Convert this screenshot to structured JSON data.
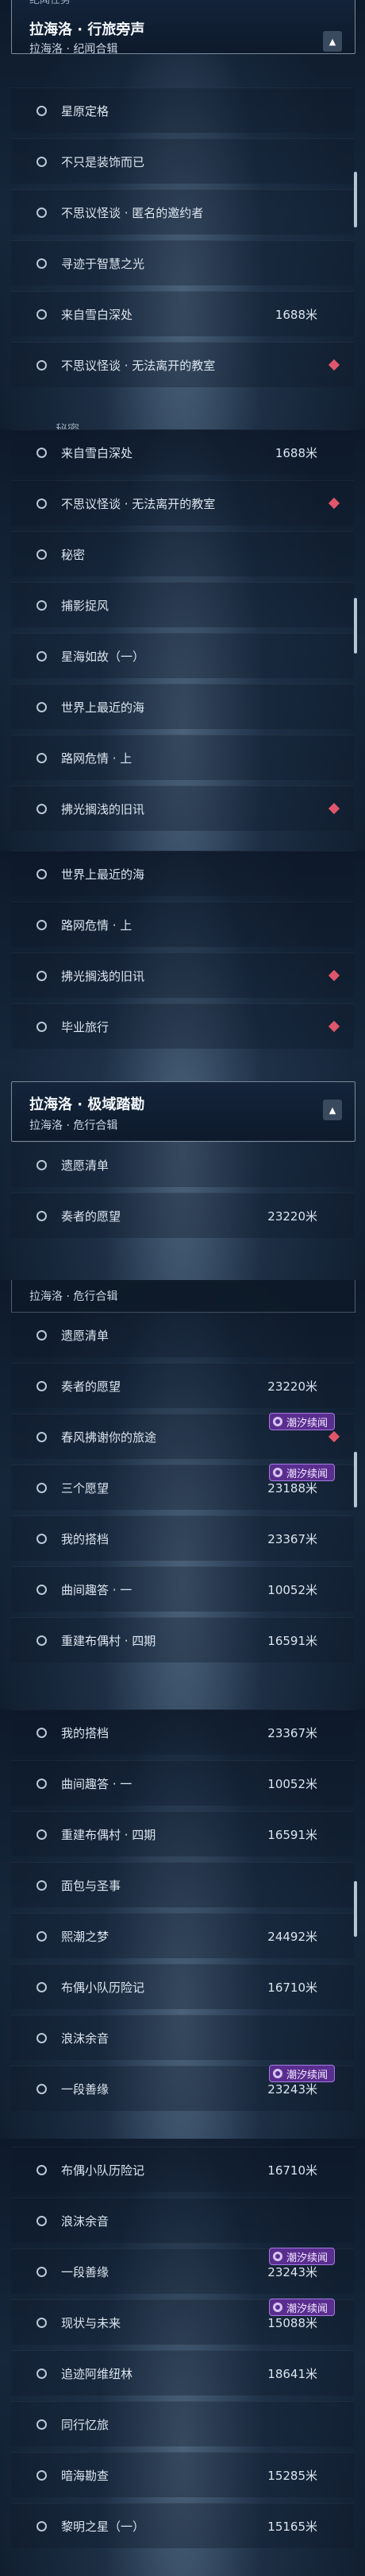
{
  "top_tab": "纪闻任务",
  "groups": {
    "laihailuo_xinglv": {
      "title": "拉海洛 · 行旅旁声",
      "subtitle": "拉海洛 · 纪闻合辑"
    },
    "laihailuo_jiyu": {
      "title": "拉海洛 · 极域踏勘",
      "subtitle": "拉海洛 · 危行合辑"
    }
  },
  "partial_label": "秘密",
  "tag_label": "潮汐续闻",
  "strips": [
    {
      "rows": [
        {
          "label": "星原定格",
          "dist": "",
          "marker": false
        },
        {
          "label": "不只是装饰而已",
          "dist": "",
          "marker": false
        },
        {
          "label": "不思议怪谈 · 匿名的邀约者",
          "dist": "",
          "marker": false
        },
        {
          "label": "寻迹于智慧之光",
          "dist": "",
          "marker": false
        },
        {
          "label": "来自雪白深处",
          "dist": "1688米",
          "marker": false
        },
        {
          "label": "不思议怪谈 · 无法离开的教室",
          "dist": "",
          "marker": true
        }
      ]
    },
    {
      "rows": [
        {
          "label": "来自雪白深处",
          "dist": "1688米",
          "marker": false
        },
        {
          "label": "不思议怪谈 · 无法离开的教室",
          "dist": "",
          "marker": true
        },
        {
          "label": "秘密",
          "dist": "",
          "marker": false
        },
        {
          "label": "捕影捉风",
          "dist": "",
          "marker": false
        },
        {
          "label": "星海如故（一）",
          "dist": "",
          "marker": false
        },
        {
          "label": "世界上最近的海",
          "dist": "",
          "marker": false
        },
        {
          "label": "路网危情 · 上",
          "dist": "",
          "marker": false
        },
        {
          "label": "拂光搁浅的旧讯",
          "dist": "",
          "marker": true
        }
      ]
    },
    {
      "rows": [
        {
          "label": "世界上最近的海",
          "dist": "",
          "marker": false
        },
        {
          "label": "路网危情 · 上",
          "dist": "",
          "marker": false
        },
        {
          "label": "拂光搁浅的旧讯",
          "dist": "",
          "marker": true
        },
        {
          "label": "毕业旅行",
          "dist": "",
          "marker": true
        }
      ],
      "rows2": [
        {
          "label": "遗愿清单",
          "dist": "",
          "marker": false
        },
        {
          "label": "奏者的愿望",
          "dist": "23220米",
          "marker": false
        }
      ]
    },
    {
      "rows": [
        {
          "label": "遗愿清单",
          "dist": "",
          "marker": false
        },
        {
          "label": "奏者的愿望",
          "dist": "23220米",
          "marker": false
        },
        {
          "label": "春风拂谢你的旅途",
          "dist": "",
          "marker": true,
          "tag": true
        },
        {
          "label": "三个愿望",
          "dist": "23188米",
          "marker": false,
          "tag": true
        },
        {
          "label": "我的搭档",
          "dist": "23367米",
          "marker": false
        },
        {
          "label": "曲间趣答 · 一",
          "dist": "10052米",
          "marker": false
        },
        {
          "label": "重建布偶村 · 四期",
          "dist": "16591米",
          "marker": false
        }
      ]
    },
    {
      "rows": [
        {
          "label": "我的搭档",
          "dist": "23367米",
          "marker": false
        },
        {
          "label": "曲间趣答 · 一",
          "dist": "10052米",
          "marker": false
        },
        {
          "label": "重建布偶村 · 四期",
          "dist": "16591米",
          "marker": false
        },
        {
          "label": "面包与圣事",
          "dist": "",
          "marker": false
        },
        {
          "label": "熙潮之梦",
          "dist": "24492米",
          "marker": false
        },
        {
          "label": "布偶小队历险记",
          "dist": "16710米",
          "marker": false
        },
        {
          "label": "浪沫余音",
          "dist": "",
          "marker": false
        },
        {
          "label": "一段善缘",
          "dist": "23243米",
          "marker": false,
          "tag": true
        }
      ]
    },
    {
      "rows": [
        {
          "label": "布偶小队历险记",
          "dist": "16710米",
          "marker": false
        },
        {
          "label": "浪沫余音",
          "dist": "",
          "marker": false
        },
        {
          "label": "一段善缘",
          "dist": "23243米",
          "marker": false,
          "tag": true
        },
        {
          "label": "现状与未来",
          "dist": "15088米",
          "marker": false,
          "tag": true
        },
        {
          "label": "追迹阿维纽林",
          "dist": "18641米",
          "marker": false
        },
        {
          "label": "同行忆旅",
          "dist": "",
          "marker": false
        },
        {
          "label": "暗海勘查",
          "dist": "15285米",
          "marker": false
        },
        {
          "label": "黎明之星（一）",
          "dist": "15165米",
          "marker": false
        }
      ]
    }
  ]
}
